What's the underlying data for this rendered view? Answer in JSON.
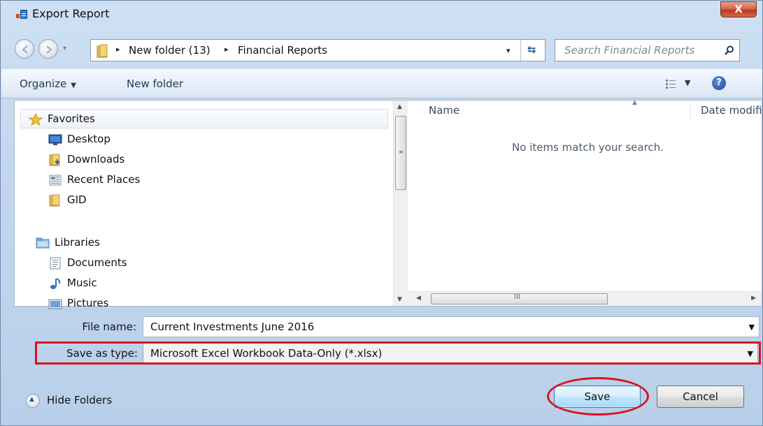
{
  "window": {
    "title": "Export Report",
    "close_glyph": "X"
  },
  "address_bar": {
    "crumbs": [
      "New folder (13)",
      "Financial Reports"
    ],
    "separator_glyph": "▸",
    "dropdown_glyph": "▾",
    "refresh_glyph": "⇆"
  },
  "search": {
    "placeholder": "Search Financial Reports"
  },
  "toolbar": {
    "organize_label": "Organize",
    "organize_caret": "▼",
    "new_folder_label": "New folder",
    "view_caret": "▼",
    "help_glyph": "?"
  },
  "nav_pane": {
    "favorites": {
      "header": "Favorites",
      "items": [
        {
          "label": "Desktop",
          "icon": "desktop-icon"
        },
        {
          "label": "Downloads",
          "icon": "downloads-folder-icon"
        },
        {
          "label": "Recent Places",
          "icon": "recent-places-icon"
        },
        {
          "label": "GID",
          "icon": "folder-icon"
        }
      ]
    },
    "libraries": {
      "header": "Libraries",
      "items": [
        {
          "label": "Documents",
          "icon": "documents-icon"
        },
        {
          "label": "Music",
          "icon": "music-icon"
        },
        {
          "label": "Pictures",
          "icon": "pictures-icon"
        }
      ]
    }
  },
  "file_list": {
    "columns": [
      "Name",
      "Date modifi"
    ],
    "empty_message": "No items match your search."
  },
  "scrollbar_glyphs": {
    "up": "▲",
    "down": "▼",
    "left": "◀",
    "right": "▶",
    "v_grip": "≡",
    "h_grip": "III"
  },
  "form": {
    "file_name_label": "File name:",
    "file_name_value": "Current Investments June 2016",
    "save_type_label": "Save as type:",
    "save_type_value": "Microsoft Excel Workbook Data-Only (*.xlsx)",
    "caret": "▼"
  },
  "footer": {
    "hide_folders_label": "Hide Folders",
    "hide_folders_glyph": "▲",
    "save_label": "Save",
    "cancel_label": "Cancel"
  },
  "colors": {
    "highlight_red": "#d9151d",
    "window_blue": "#c2d7ef",
    "save_button_blue": "#bee6fd"
  }
}
